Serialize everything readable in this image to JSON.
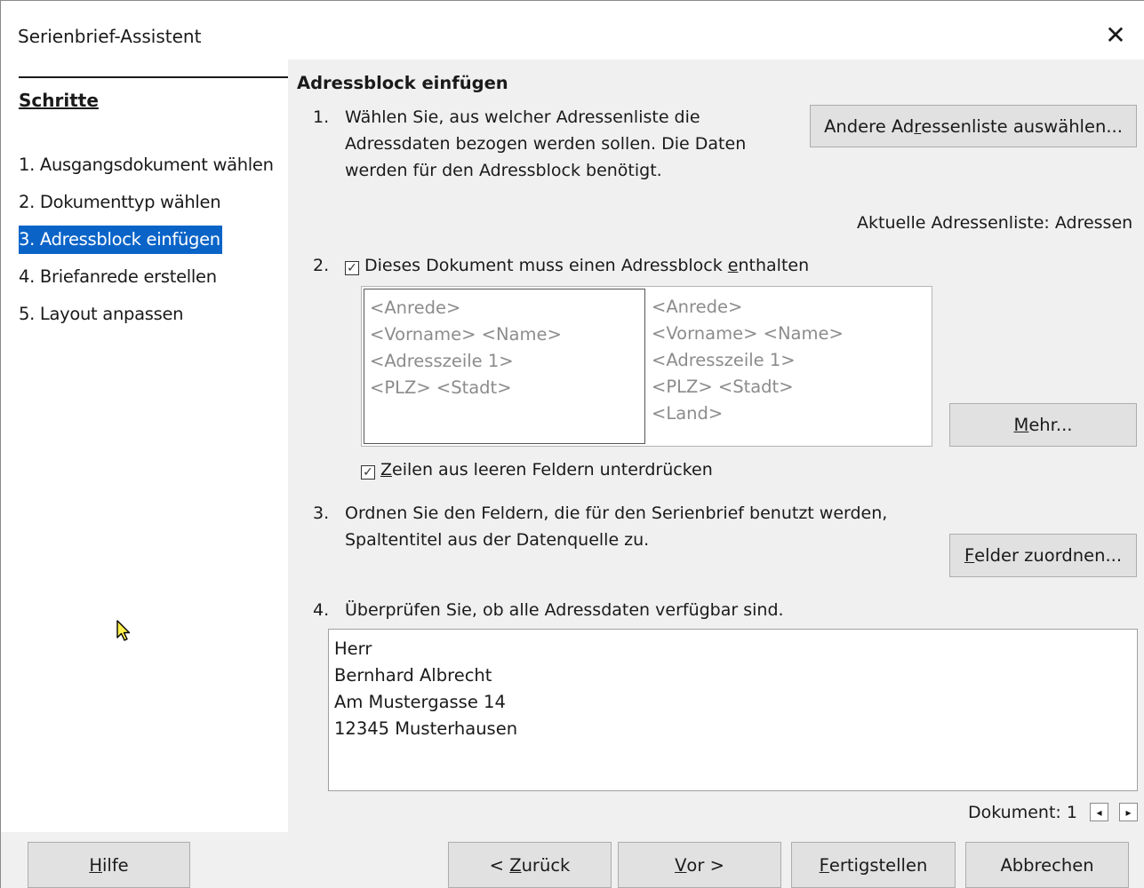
{
  "window": {
    "title": "Serienbrief-Assistent"
  },
  "sidebar": {
    "heading": "Schritte",
    "steps": [
      {
        "label": "1. Ausgangsdokument wählen"
      },
      {
        "label": "2. Dokumenttyp wählen"
      },
      {
        "label": "3. Adressblock einfügen",
        "active": true
      },
      {
        "label": "4. Briefanrede erstellen"
      },
      {
        "label": "5. Layout anpassen"
      }
    ]
  },
  "content": {
    "title": "Adressblock einfügen",
    "step1": {
      "number": "1.",
      "text": "Wählen Sie, aus welcher Adressenliste die Adressdaten bezogen werden sollen. Die Daten werden für den Adressblock benötigt.",
      "button_pre": "Andere Ad",
      "button_accel": "r",
      "button_post": "essenliste auswählen...",
      "current_list": "Aktuelle Adressenliste: Adressen"
    },
    "step2": {
      "number": "2.",
      "checkbox_pre": "Dieses Dokument muss einen Adressblock ",
      "checkbox_accel": "e",
      "checkbox_post": "nthalten",
      "checked": true,
      "block_left": [
        "<Anrede>",
        "<Vorname> <Name>",
        "<Adresszeile 1>",
        "<PLZ> <Stadt>"
      ],
      "block_right": [
        "<Anrede>",
        "<Vorname> <Name>",
        "<Adresszeile 1>",
        "<PLZ> <Stadt>",
        "<Land>"
      ],
      "more_accel": "M",
      "more_rest": "ehr...",
      "suppress_accel": "Z",
      "suppress_rest": "eilen aus leeren Feldern unterdrücken",
      "suppress_checked": true
    },
    "step3": {
      "number": "3.",
      "line1": "Ordnen Sie den Feldern, die für den Serienbrief benutzt werden,",
      "line2": "Spaltentitel aus der Datenquelle zu.",
      "button_accel": "F",
      "button_rest": "elder zuordnen..."
    },
    "step4": {
      "number": "4.",
      "text": "Überprüfen Sie, ob alle Adressdaten verfügbar sind.",
      "preview_lines": [
        "Herr",
        "Bernhard Albrecht",
        "Am Mustergasse 14",
        "12345 Musterhausen"
      ],
      "doc_label": "Dokument: 1"
    }
  },
  "footer": {
    "help_accel": "H",
    "help_rest": "ilfe",
    "back_pre": "< ",
    "back_accel": "Z",
    "back_rest": "urück",
    "next_accel": "V",
    "next_rest": "or >",
    "finish_accel": "F",
    "finish_rest": "ertigstellen",
    "cancel": "Abbrechen"
  },
  "colors": {
    "accent": "#0a64c8",
    "panel": "#f0f0f0",
    "button": "#e1e1e1"
  }
}
